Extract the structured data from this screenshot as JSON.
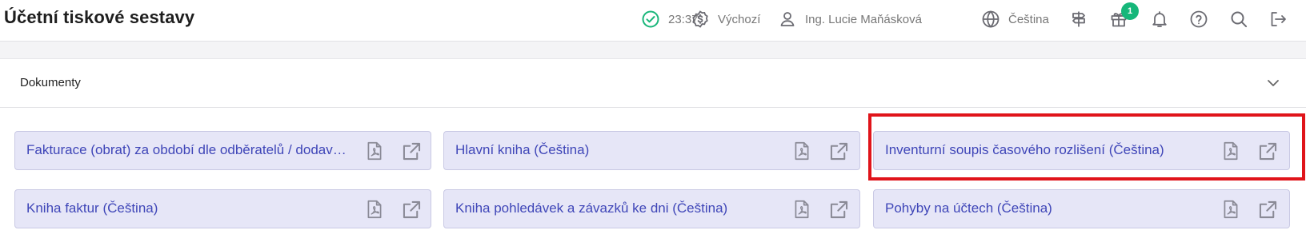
{
  "header": {
    "title": "Účetní tiskové sestavy",
    "status_icon": "check-circle-icon",
    "time": "23:37",
    "currency_icon": "dollar-badge-icon",
    "currency": "Výchozí",
    "user_icon": "user-icon",
    "user": "Ing. Lucie Maňásková",
    "language_icon": "globe-icon",
    "language": "Čeština",
    "gift_badge": "1"
  },
  "panel": {
    "title": "Dokumenty"
  },
  "reports": [
    {
      "label": "Fakturace (obrat) za období dle odběratelů / dodav…"
    },
    {
      "label": "Hlavní kniha (Čeština)"
    },
    {
      "label": "Inventurní soupis časového rozlišení (Čeština)"
    },
    {
      "label": "Kniha faktur (Čeština)"
    },
    {
      "label": "Kniha pohledávek a závazků ke dni (Čeština)"
    },
    {
      "label": "Pohyby na účtech (Čeština)"
    }
  ],
  "colors": {
    "accent": "#3f46b8",
    "card_bg": "#e6e6f7",
    "badge": "#16b77a",
    "status_ok": "#19b67a",
    "highlight": "#e0141a"
  }
}
